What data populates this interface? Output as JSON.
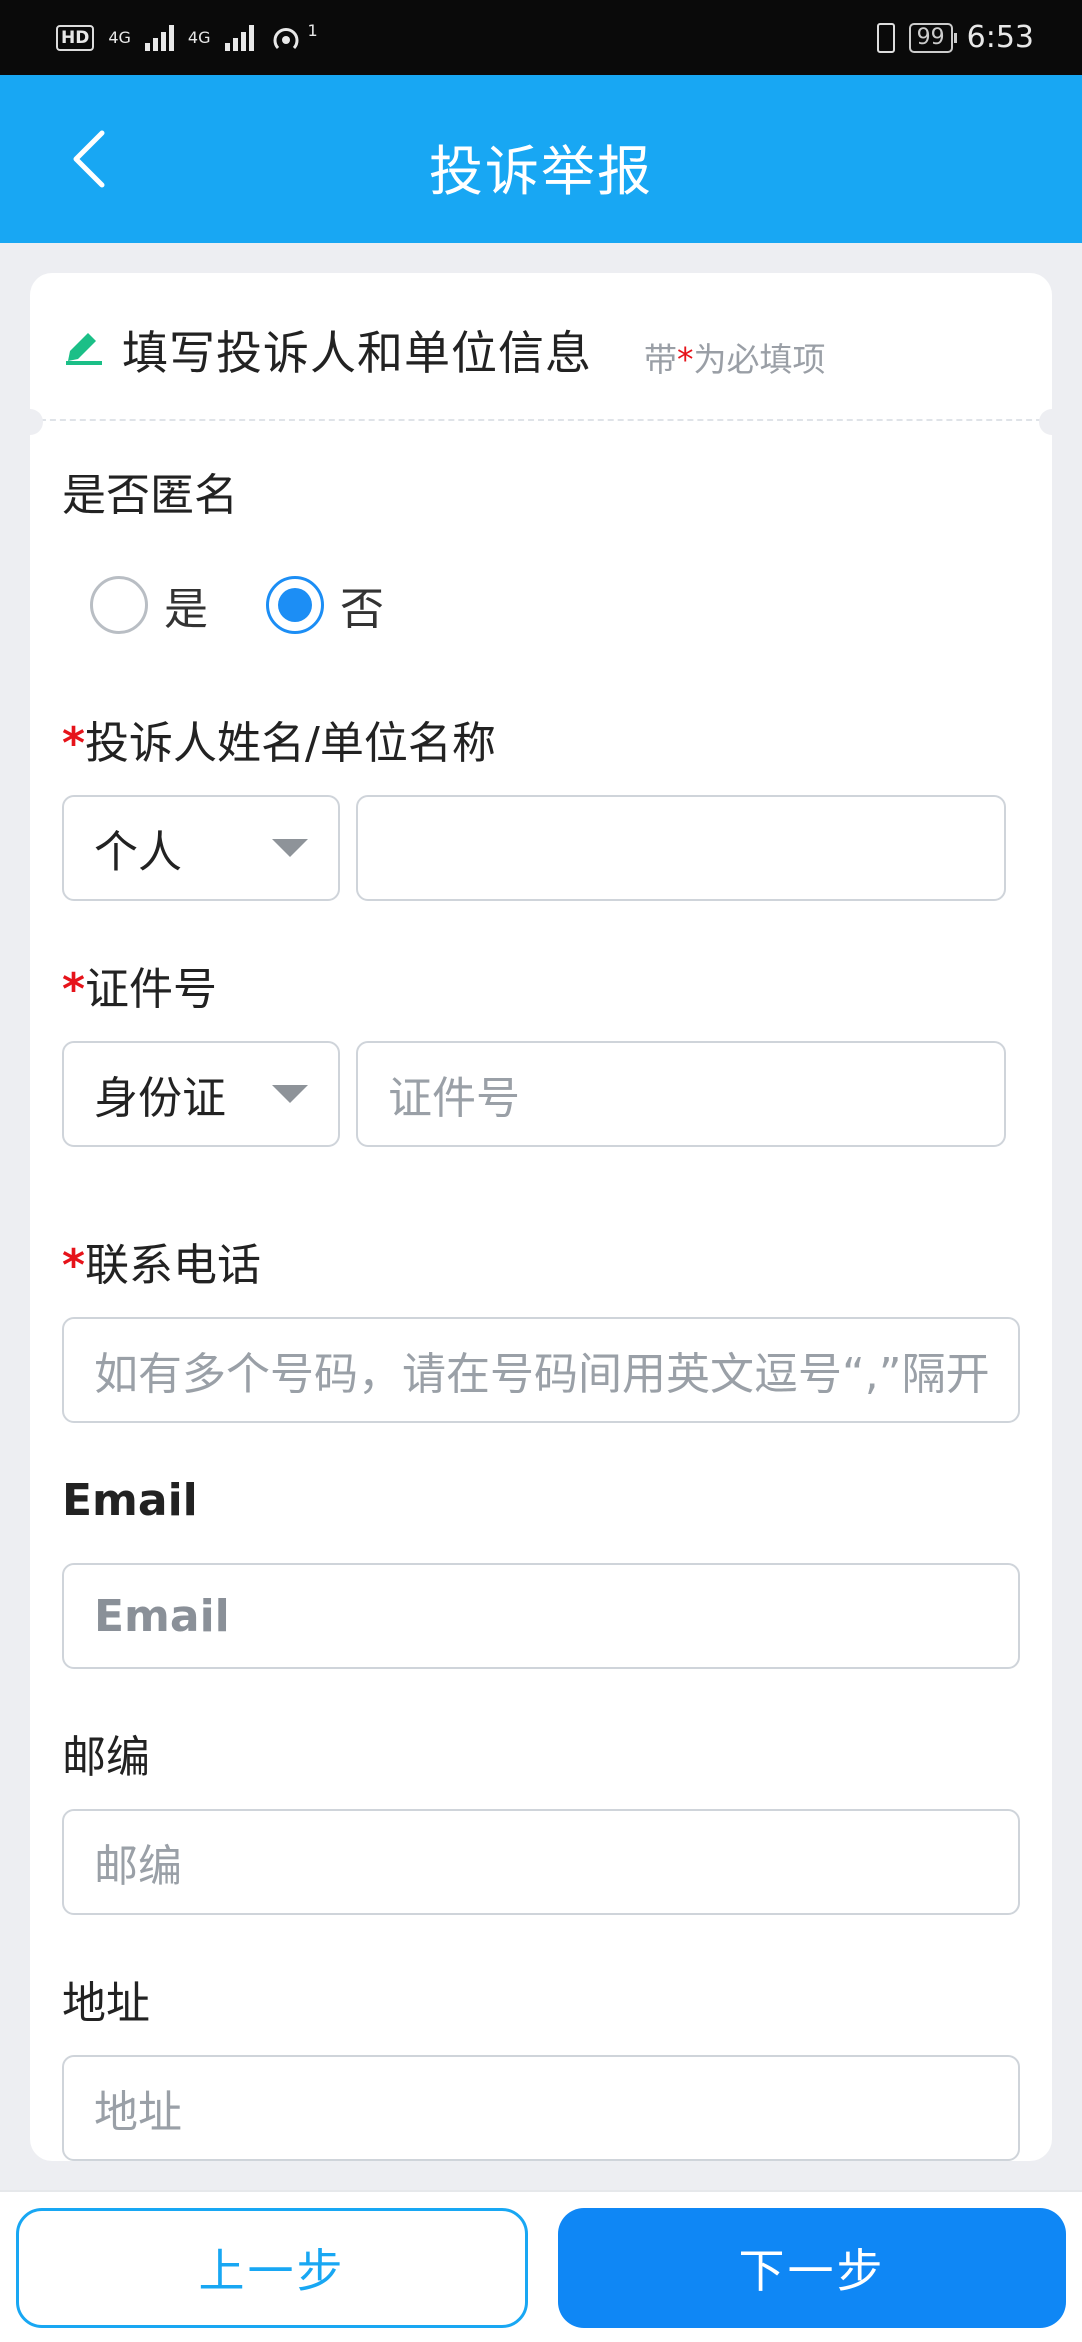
{
  "status_bar": {
    "hd": "HD",
    "net1": "4G",
    "net2": "4G",
    "hotspot_badge": "1",
    "battery": "99",
    "time": "6:53"
  },
  "header": {
    "title": "投诉举报",
    "back_icon": "chevron-left-icon"
  },
  "section": {
    "title": "填写投诉人和单位信息",
    "hint_prefix": "带",
    "hint_star": "*",
    "hint_suffix": "为必填项",
    "icon": "edit-icon"
  },
  "anonymous": {
    "label": "是否匿名",
    "options": [
      "是",
      "否"
    ],
    "selected": "否"
  },
  "name": {
    "label": "投诉人姓名/单位名称",
    "type_value": "个人",
    "value": ""
  },
  "id_number": {
    "label": "证件号",
    "type_value": "身份证",
    "placeholder": "证件号"
  },
  "phone": {
    "label": "联系电话",
    "placeholder": "如有多个号码，请在号码间用英文逗号“,”隔开"
  },
  "email": {
    "label": "Email",
    "placeholder": "Email"
  },
  "postcode": {
    "label": "邮编",
    "placeholder": "邮编"
  },
  "address": {
    "label": "地址",
    "placeholder": "地址"
  },
  "required_mark": "*",
  "footer": {
    "prev_label": "上一步",
    "next_label": "下一步"
  },
  "colors": {
    "brand_blue": "#18a7f3",
    "button_blue": "#0f87f5",
    "required_red": "#e6131a",
    "radio_selected": "#1c8ef5"
  }
}
